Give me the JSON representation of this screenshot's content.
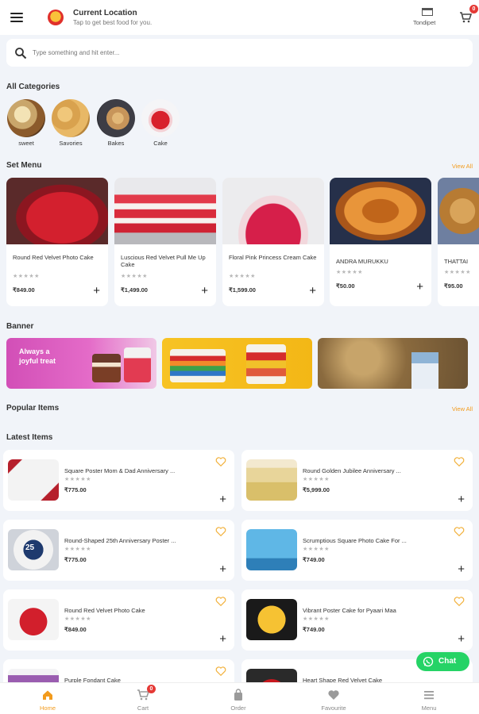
{
  "header": {
    "location_title": "Current Location",
    "location_subtitle": "Tap to get best food for you.",
    "store_name": "Tondipet",
    "cart_count": "0"
  },
  "search": {
    "placeholder": "Type something and hit enter..."
  },
  "categories": {
    "title": "All Categories",
    "items": [
      {
        "label": "sweet"
      },
      {
        "label": "Savories"
      },
      {
        "label": "Bakes"
      },
      {
        "label": "Cake"
      }
    ]
  },
  "set_menu": {
    "title": "Set Menu",
    "view_all": "View All",
    "stars": "★★★★★",
    "items": [
      {
        "name": "Round Red Velvet Photo Cake",
        "price": "₹849.00"
      },
      {
        "name": "Luscious Red Velvet Pull Me Up Cake",
        "price": "₹1,499.00"
      },
      {
        "name": "Floral Pink Princess Cream Cake",
        "price": "₹1,599.00"
      },
      {
        "name": "ANDRA MURUKKU",
        "price": "₹50.00"
      },
      {
        "name": "THATTAI",
        "price": "₹95.00"
      }
    ]
  },
  "banner": {
    "title": "Banner",
    "banner1_text_line1": "Always a",
    "banner1_text_line2": "joyful treat"
  },
  "popular": {
    "title": "Popular Items",
    "view_all": "View All"
  },
  "latest": {
    "title": "Latest Items",
    "stars": "★★★★★",
    "items": [
      {
        "name": "Square Poster Mom & Dad Anniversary ...",
        "price": "₹775.00"
      },
      {
        "name": "Round Golden Jubilee Anniversary ...",
        "price": "₹5,999.00"
      },
      {
        "name": "Round-Shaped 25th Anniversary Poster ...",
        "price": "₹775.00"
      },
      {
        "name": "Scrumptious Square Photo Cake For ...",
        "price": "₹749.00"
      },
      {
        "name": "Round Red Velvet Photo Cake",
        "price": "₹849.00"
      },
      {
        "name": "Vibrant Poster Cake for Pyaari Maa",
        "price": "₹749.00"
      },
      {
        "name": "Purple Fondant Cake",
        "price": ""
      },
      {
        "name": "Heart Shape Red Velvet Cake",
        "price": ""
      }
    ],
    "thumb_label_25": "25"
  },
  "chat": {
    "label": "Chat"
  },
  "nav": {
    "items": [
      {
        "label": "Home"
      },
      {
        "label": "Cart"
      },
      {
        "label": "Order"
      },
      {
        "label": "Favourite"
      },
      {
        "label": "Menu"
      }
    ],
    "cart_badge": "0"
  },
  "colors": {
    "accent": "#f29b1d",
    "chat_green": "#25d366",
    "badge_red": "#e53935"
  }
}
